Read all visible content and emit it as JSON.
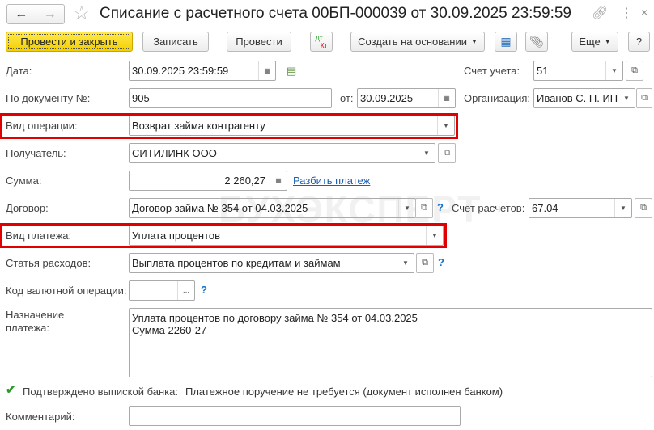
{
  "title": "Списание с расчетного счета 00БП-000039 от 30.09.2025 23:59:59",
  "watermark": "БУХЭКСПЕРТ",
  "toolbar": {
    "post_close": "Провести и закрыть",
    "save": "Записать",
    "post": "Провести",
    "dt": "Дт",
    "kt": "Кт",
    "create_based": "Создать на основании",
    "more": "Еще",
    "help": "?"
  },
  "form": {
    "date_label": "Дата:",
    "date": "30.09.2025 23:59:59",
    "account_label": "Счет учета:",
    "account": "51",
    "docnum_label": "По документу №:",
    "docnum": "905",
    "from_label": "от:",
    "from_date": "30.09.2025",
    "org_label": "Организация:",
    "org": "Иванов С. П. ИП",
    "op_label": "Вид операции:",
    "op": "Возврат займа контрагенту",
    "recipient_label": "Получатель:",
    "recipient": "СИТИЛИНК ООО",
    "sum_label": "Сумма:",
    "sum": "2 260,27",
    "split_link": "Разбить платеж",
    "contract_label": "Договор:",
    "contract": "Договор займа № 354 от 04.03.2025",
    "settle_label": "Счет расчетов:",
    "settle": "67.04",
    "paytype_label": "Вид платежа:",
    "paytype": "Уплата процентов",
    "expense_label": "Статья расходов:",
    "expense": "Выплата процентов по кредитам и займам",
    "currency_label": "Код валютной операции:",
    "currency": "",
    "purpose_label1": "Назначение",
    "purpose_label2": "платежа:",
    "purpose_line1": "Уплата процентов по договору займа № 354 от 04.03.2025",
    "purpose_line2": "Сумма 2260-27",
    "confirmed_label": "Подтверждено выпиской банка:",
    "confirmed": true,
    "confirmed_text": "Платежное поручение не требуется (документ исполнен банком)",
    "comment_label": "Комментарий:",
    "comment": "",
    "help_q": "?"
  }
}
